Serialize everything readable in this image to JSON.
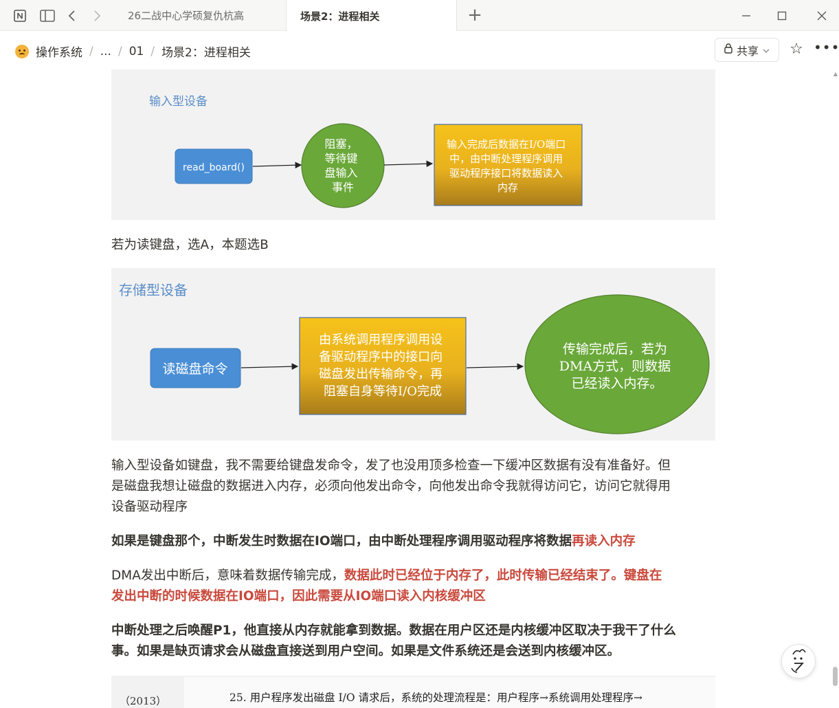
{
  "tabs": [
    {
      "label": "26二战中心学硕复仇杭高",
      "active": false
    },
    {
      "label": "场景2：进程相关",
      "active": true
    }
  ],
  "breadcrumb": {
    "workspace": "操作系统",
    "ellipsis": "...",
    "parent": "01",
    "current": "场景2：进程相关"
  },
  "header": {
    "share_label": "共享"
  },
  "figure1": {
    "title": "输入型设备",
    "node1": "read_board()",
    "node2_lines": [
      "阻塞，",
      "等待键",
      "盘输入",
      "事件"
    ],
    "node3_lines": [
      "输入完成后数据在I/O端口",
      "中，由中断处理程序调用",
      "驱动程序接口将数据读入",
      "内存"
    ]
  },
  "para1": "若为读键盘，选A，本题选B",
  "figure2": {
    "title": "存储型设备",
    "node1": "读磁盘命令",
    "node2_lines": [
      "由系统调用程序调用设",
      "备驱动程序中的接口向",
      "磁盘发出传输命令，再",
      "阻塞自身等待I/O完成"
    ],
    "node3_lines": [
      "传输完成后，若为",
      "DMA方式，则数据",
      "已经读入内存。"
    ]
  },
  "para2_lines": [
    "输入型设备如键盘，我不需要给键盘发命令，发了也没用顶多检查一下缓冲区数据有没有准备好。但",
    "是磁盘我想让磁盘的数据进入内存，必须向他发出命令，向他发出命令我就得访问它，访问它就得用",
    "设备驱动程序"
  ],
  "para3": {
    "bold": "如果是键盘那个，中断发生时数据在IO端口，由中断处理程序调用驱动程序将数据",
    "red": "再读入内存"
  },
  "para4": {
    "plain": "DMA发出中断后，意味着数据传输完成，",
    "red1": "数据此时已经位于内存了，此时传输已经结束了。键盘在",
    "red2": "发出中断的时候数据在IO端口，因此需要从IO端口读入内核缓冲区"
  },
  "para5_lines": [
    "中断处理之后唤醒P1，他直接从内存就能拿到数据。数据在用户区还是内核缓冲区取决于我干了什么",
    "事。如果是缺页请求会从磁盘直接送到用户空间。如果是文件系统还是会送到内核缓冲区。"
  ],
  "exam": {
    "year": "（2013）",
    "question": "25. 用户程序发出磁盘 I/O 请求后，系统的处理流程是：用户程序→系统调用处理程序→"
  },
  "colors": {
    "blue_node": "#4a8fd6",
    "green_node": "#6aa839",
    "gold_top": "#f6c21a",
    "gold_bottom": "#a87c1b",
    "red_text": "#c9493c",
    "figure_bg": "#f2f2f2"
  }
}
